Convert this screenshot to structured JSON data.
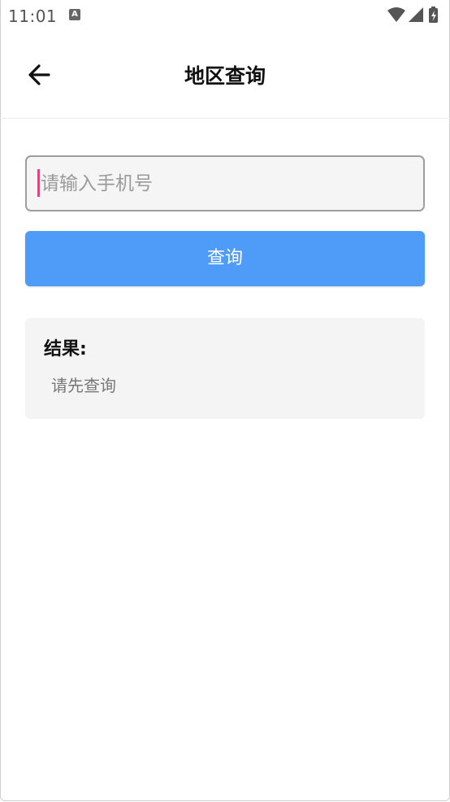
{
  "status_bar": {
    "time": "11:01",
    "notification_icon_letter": "A",
    "icons": [
      "wifi-icon",
      "signal-icon",
      "battery-charging-icon"
    ]
  },
  "app_bar": {
    "back_icon": "arrow-left-icon",
    "title": "地区查询"
  },
  "form": {
    "phone_input": {
      "value": "",
      "placeholder": "请输入手机号"
    },
    "query_button_label": "查询"
  },
  "result": {
    "title": "结果:",
    "text": "请先查询"
  },
  "colors": {
    "primary_button": "#4f9bf8",
    "caret": "#e0457b",
    "card_background": "#f4f4f4",
    "input_border": "#9e9e9e"
  }
}
